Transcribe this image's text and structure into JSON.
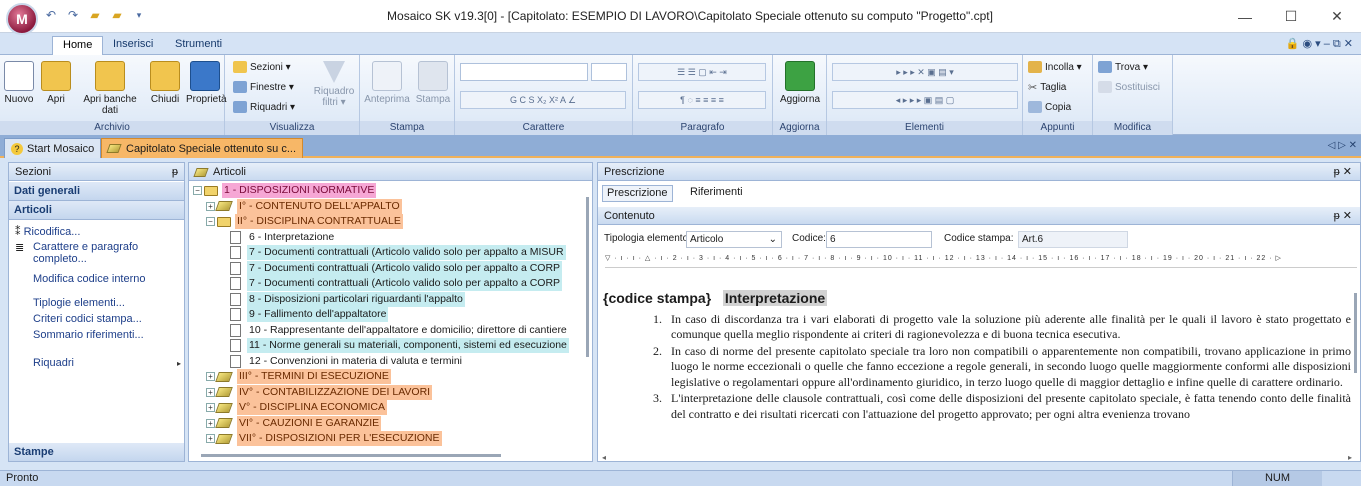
{
  "app": {
    "orb_letter": "M",
    "title": "Mosaico SK v19.3[0] - [Capitolato: ESEMPIO DI LAVORO\\Capitolato Speciale ottenuto su computo \"Progetto\".cpt]",
    "minimize": "—",
    "maximize": "☐",
    "close": "✕"
  },
  "ribbon_tabs": [
    {
      "label": "Home"
    },
    {
      "label": "Inserisci"
    },
    {
      "label": "Strumenti"
    }
  ],
  "help_icons": "🔒 ◉ ▾ – ⧉ ✕",
  "ribbon": {
    "archivio": {
      "caption": "Archivio",
      "nuovo": "Nuovo",
      "apri": "Apri",
      "apri_banche": "Apri banche dati",
      "chiudi": "Chiudi",
      "proprieta": "Proprietà"
    },
    "visualizza": {
      "caption": "Visualizza",
      "sezioni": "Sezioni ▾",
      "finestre": "Finestre ▾",
      "riquadri": "Riquadri ▾",
      "riquadro_filtri": "Riquadro filtri ▾"
    },
    "stampa": {
      "caption": "Stampa",
      "anteprima": "Anteprima",
      "stampa": "Stampa"
    },
    "carattere": {
      "caption": "Carattere"
    },
    "paragrafo": {
      "caption": "Paragrafo"
    },
    "aggiorna": {
      "caption": "Aggiorna",
      "label": "Aggiorna"
    },
    "elementi": {
      "caption": "Elementi"
    },
    "appunti": {
      "caption": "Appunti",
      "incolla": "Incolla ▾",
      "taglia": "Taglia",
      "copia": "Copia"
    },
    "modifica": {
      "caption": "Modifica",
      "trova": "Trova ▾",
      "sostituisci": "Sostituisci"
    }
  },
  "doc_tabs": [
    {
      "label": "Start Mosaico"
    },
    {
      "label": "Capitolato Speciale ottenuto su c..."
    }
  ],
  "doc_tabs_nav": "◁ ▷ ✕",
  "left_panel": {
    "header": "Sezioni",
    "pin": "ᵽ",
    "dati_generali": "Dati generali",
    "articoli": "Articoli",
    "items": [
      "Ricodifica...",
      "Carattere e paragrafo completo...",
      "Modifica codice interno",
      "Tiplogie elementi...",
      "Criteri codici stampa...",
      "Sommario riferimenti...",
      "Riquadri"
    ],
    "stampe": "Stampe"
  },
  "tree": {
    "header": "Articoli",
    "rows": [
      {
        "text": "1 -   DISPOSIZIONI NORMATIVE",
        "level": 0,
        "icon": "book",
        "exp": "−",
        "hl": "pink"
      },
      {
        "text": "I° -    CONTENUTO DELL'APPALTO",
        "level": 1,
        "icon": "diamond",
        "exp": "+",
        "hl": "orange"
      },
      {
        "text": "II° -    DISCIPLINA CONTRATTUALE",
        "level": 1,
        "icon": "book",
        "exp": "−",
        "hl": "orange"
      },
      {
        "text": "6 -   Interpretazione",
        "level": 2,
        "icon": "doc",
        "exp": "",
        "hl": ""
      },
      {
        "text": "7 -   Documenti contrattuali  (Articolo valido solo per appalto a MISUR",
        "level": 2,
        "icon": "doc",
        "exp": "",
        "hl": "cyan"
      },
      {
        "text": "7 -   Documenti contrattuali  (Articolo valido solo per appalto a CORP",
        "level": 2,
        "icon": "doc",
        "exp": "",
        "hl": "cyan"
      },
      {
        "text": "7 -   Documenti contrattuali  (Articolo valido solo per appalto a CORP",
        "level": 2,
        "icon": "doc",
        "exp": "",
        "hl": "cyan"
      },
      {
        "text": "8 -   Disposizioni particolari riguardanti l'appalto",
        "level": 2,
        "icon": "doc",
        "exp": "",
        "hl": "cyan"
      },
      {
        "text": "9 -   Fallimento dell'appaltatore",
        "level": 2,
        "icon": "doc",
        "exp": "",
        "hl": "cyan"
      },
      {
        "text": "10 -   Rappresentante dell'appaltatore e domicilio; direttore di cantiere",
        "level": 2,
        "icon": "doc",
        "exp": "",
        "hl": ""
      },
      {
        "text": "11 -   Norme generali su materiali, componenti, sistemi ed esecuzione",
        "level": 2,
        "icon": "doc",
        "exp": "",
        "hl": "cyan"
      },
      {
        "text": "12 -   Convenzioni in materia di valuta e termini",
        "level": 2,
        "icon": "doc",
        "exp": "",
        "hl": ""
      },
      {
        "text": "III° -    TERMINI DI ESECUZIONE",
        "level": 1,
        "icon": "diamond",
        "exp": "+",
        "hl": "orange"
      },
      {
        "text": "IV° -    CONTABILIZZAZIONE DEI LAVORI",
        "level": 1,
        "icon": "diamond",
        "exp": "+",
        "hl": "orange"
      },
      {
        "text": "V° -    DISCIPLINA ECONOMICA",
        "level": 1,
        "icon": "diamond",
        "exp": "+",
        "hl": "orange"
      },
      {
        "text": "VI° -    CAUZIONI E GARANZIE",
        "level": 1,
        "icon": "diamond",
        "exp": "+",
        "hl": "orange"
      },
      {
        "text": "VII° -    DISPOSIZIONI PER L'ESECUZIONE",
        "level": 1,
        "icon": "diamond",
        "exp": "+",
        "hl": "orange"
      }
    ]
  },
  "right": {
    "header": "Prescrizione",
    "pin": "ᵽ ✕",
    "tabs": [
      "Prescrizione",
      "Riferimenti"
    ],
    "contenuto": "Contenuto",
    "tipologia_label": "Tipologia elemento:",
    "tipologia_value": "Articolo",
    "codice_label": "Codice:",
    "codice_value": "6",
    "codice_stampa_label": "Codice stampa:",
    "codice_stampa_value": "Art.6",
    "ruler": "▽ · ı · ı · △ · ı · 2 · ı · 3 · ı · 4 · ı · 5 · ı · 6 · ı · 7 · ı · 8 · ı · 9 · ı · 10 · ı · 11 · ı · 12 · ı · 13 · ı · 14 · ı · 15 · ı · 16 · ı · 17 · ı · 18 · ı · 19 · ı · 20 · ı · 21 · ı · 22 · ▷",
    "heading_code": "{codice stampa}",
    "heading_title": "Interpretazione",
    "paragraphs": [
      {
        "num": "1.",
        "text": "In caso di discordanza tra i vari elaborati di progetto vale la soluzione più aderente alle finalità per le quali il lavoro è stato progettato e comunque quella meglio rispondente ai criteri di ragionevolezza e di buona tecnica esecutiva."
      },
      {
        "num": "2.",
        "text": "In caso di norme del presente capitolato speciale tra loro non compatibili o apparentemente non compatibili, trovano applicazione in primo luogo le norme eccezionali o quelle che fanno eccezione a regole generali, in secondo luogo quelle maggiormente conformi alle disposizioni legislative o regolamentari oppure all'ordinamento giuridico, in terzo luogo quelle di maggior dettaglio e infine quelle di carattere ordinario."
      },
      {
        "num": "3.",
        "text": "L'interpretazione delle clausole contrattuali, così come delle disposizioni del presente capitolato speciale, è fatta tenendo conto delle finalità del contratto e dei risultati ricercati con l'attuazione del progetto approvato; per ogni altra evenienza trovano"
      }
    ]
  },
  "status": {
    "text": "Pronto",
    "num": "NUM"
  }
}
